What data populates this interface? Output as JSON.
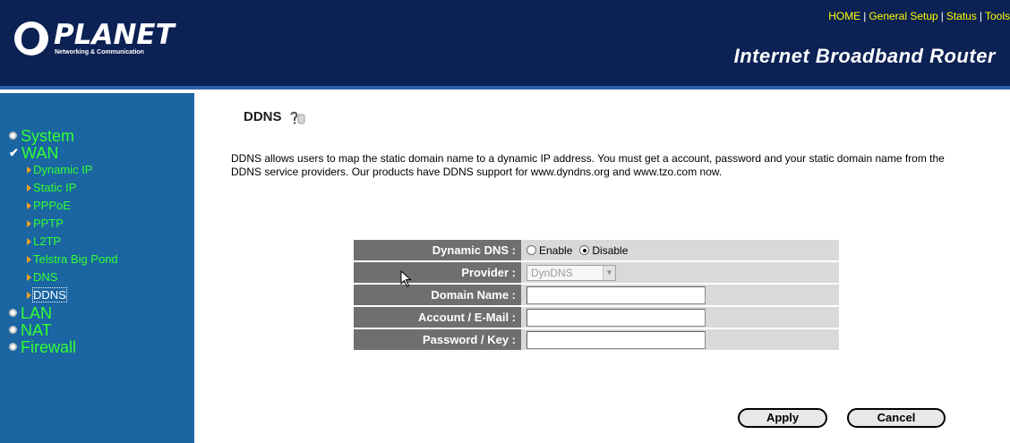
{
  "header": {
    "logo_name": "PLANET",
    "logo_tagline": "Networking & Communication",
    "product_title": "Internet Broadband Router",
    "nav": [
      {
        "label": "HOME"
      },
      {
        "label": "General Setup"
      },
      {
        "label": "Status"
      },
      {
        "label": "Tools"
      }
    ],
    "nav_separator": "|"
  },
  "sidebar": {
    "system": "System",
    "wan": "WAN",
    "wan_items": [
      {
        "label": "Dynamic IP"
      },
      {
        "label": "Static IP"
      },
      {
        "label": "PPPoE"
      },
      {
        "label": "PPTP"
      },
      {
        "label": "L2TP"
      },
      {
        "label": "Telstra Big Pond"
      },
      {
        "label": "DNS"
      },
      {
        "label": "DDNS"
      }
    ],
    "lan": "LAN",
    "nat": "NAT",
    "firewall": "Firewall",
    "active_item": "DDNS"
  },
  "main": {
    "title": "DDNS",
    "description": "DDNS allows users to map the static domain name to a dynamic IP address. You must get a account, password and your static domain name from the DDNS service providers. Our products have DDNS support for www.dyndns.org and www.tzo.com now.",
    "form": {
      "dynamic_dns_label": "Dynamic DNS :",
      "enable_label": "Enable",
      "disable_label": "Disable",
      "selected": "Disable",
      "provider_label": "Provider :",
      "provider_value": "DynDNS",
      "domain_label": "Domain Name :",
      "domain_value": "",
      "account_label": "Account / E-Mail :",
      "account_value": "",
      "password_label": "Password / Key :",
      "password_value": ""
    },
    "apply_label": "Apply",
    "cancel_label": "Cancel"
  },
  "colors": {
    "header_bg": "#0c2154",
    "sidebar_bg": "#1a65a2",
    "nav_link": "#ffff00",
    "menu_text": "#33ff33",
    "form_label_bg": "#6f6f6f",
    "form_value_bg": "#d9d9d9"
  },
  "icons": {
    "help": "help-icon",
    "cursor": "mouse-pointer-icon"
  }
}
